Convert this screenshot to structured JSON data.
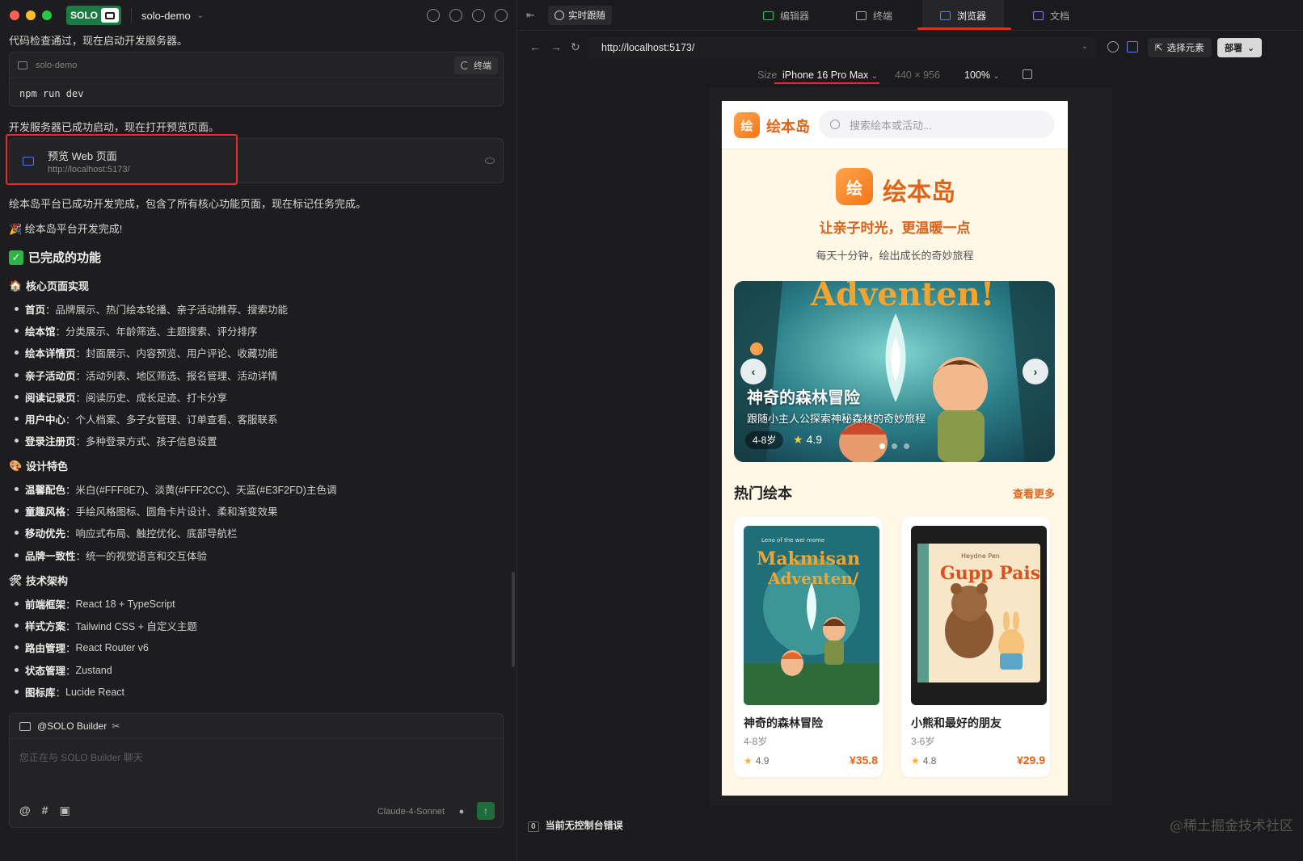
{
  "titlebar": {
    "brand": "SOLO",
    "project": "solo-demo"
  },
  "left": {
    "msg1": "代码检查通过，现在启动开发服务器。",
    "code_block": {
      "name": "solo-demo",
      "terminal_label": "终端",
      "command": "npm run dev"
    },
    "msg2": "开发服务器已成功启动，现在打开预览页面。",
    "preview_card": {
      "title": "预览 Web 页面",
      "url": "http://localhost:5173/"
    },
    "msg3": "绘本岛平台已成功开发完成，包含了所有核心功能页面，现在标记任务完成。",
    "msg4": "🎉 绘本岛平台开发完成!",
    "h2": "已完成的功能",
    "sections": [
      {
        "icon": "🏠",
        "title": "核心页面实现",
        "items": [
          {
            "k": "首页",
            "v": "品牌展示、热门绘本轮播、亲子活动推荐、搜索功能"
          },
          {
            "k": "绘本馆",
            "v": "分类展示、年龄筛选、主题搜索、评分排序"
          },
          {
            "k": "绘本详情页",
            "v": "封面展示、内容预览、用户评论、收藏功能"
          },
          {
            "k": "亲子活动页",
            "v": "活动列表、地区筛选、报名管理、活动详情"
          },
          {
            "k": "阅读记录页",
            "v": "阅读历史、成长足迹、打卡分享"
          },
          {
            "k": "用户中心",
            "v": "个人档案、多子女管理、订单查看、客服联系"
          },
          {
            "k": "登录注册页",
            "v": "多种登录方式、孩子信息设置"
          }
        ]
      },
      {
        "icon": "🎨",
        "title": "设计特色",
        "items": [
          {
            "k": "温馨配色",
            "v": "米白(#FFF8E7)、淡黄(#FFF2CC)、天蓝(#E3F2FD)主色调"
          },
          {
            "k": "童趣风格",
            "v": "手绘风格图标、圆角卡片设计、柔和渐变效果"
          },
          {
            "k": "移动优先",
            "v": "响应式布局、触控优化、底部导航栏"
          },
          {
            "k": "品牌一致性",
            "v": "统一的视觉语言和交互体验"
          }
        ]
      },
      {
        "icon": "🛠",
        "title": "技术架构",
        "items": [
          {
            "k": "前端框架",
            "v": "React 18 + TypeScript"
          },
          {
            "k": "样式方案",
            "v": "Tailwind CSS + 自定义主题"
          },
          {
            "k": "路由管理",
            "v": "React Router v6"
          },
          {
            "k": "状态管理",
            "v": "Zustand"
          },
          {
            "k": "图标库",
            "v": "Lucide React"
          }
        ]
      }
    ],
    "chat": {
      "agent": "@SOLO Builder",
      "placeholder": "您正在与 SOLO Builder 聊天",
      "model": "Claude-4-Sonnet",
      "tools": [
        "@",
        "#"
      ]
    }
  },
  "right": {
    "live_label": "实时跟随",
    "tabs": [
      "编辑器",
      "终端",
      "浏览器",
      "文档"
    ],
    "url": "http://localhost:5173/",
    "select_element": "选择元素",
    "deploy": "部署",
    "size_label": "Size",
    "device": "iPhone 16 Pro Max",
    "dims": "440 × 956",
    "zoom": "100%",
    "status_count": "0",
    "status_text": "当前无控制台错误",
    "watermark": "@稀土掘金技术社区"
  },
  "phone": {
    "logo_char": "绘",
    "brand": "绘本岛",
    "search_placeholder": "搜索绘本或活动...",
    "hero_slogan": "让亲子时光，更温暖一点",
    "hero_sub": "每天十分钟，绘出成长的奇妙旅程",
    "banner": {
      "title": "神奇的森林冒险",
      "desc": "跟随小主人公探索神秘森林的奇妙旅程",
      "age": "4-8岁",
      "rating": "4.9",
      "art_text": "Adventen!"
    },
    "section_title": "热门绘本",
    "section_more": "查看更多",
    "books": [
      {
        "name": "神奇的森林冒险",
        "age": "4-8岁",
        "rating": "4.9",
        "price": "¥35.8",
        "cover_title": "Makmisan Adventen/",
        "cover_sub": "Leno of the wei mome"
      },
      {
        "name": "小熊和最好的朋友",
        "age": "3-6岁",
        "rating": "4.8",
        "price": "¥29.9",
        "cover_title": "Gupp Pais",
        "cover_sub": "Heydne Pen"
      }
    ]
  }
}
